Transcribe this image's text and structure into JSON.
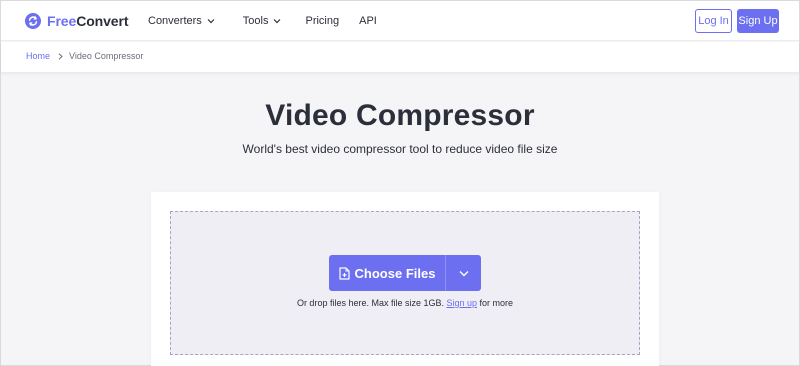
{
  "brand": {
    "free": "Free",
    "convert": "Convert",
    "accent": "#6c6ff0",
    "icon": "refresh-circle-icon"
  },
  "nav": {
    "items": [
      {
        "label": "Converters",
        "has_dropdown": true
      },
      {
        "label": "Tools",
        "has_dropdown": true
      },
      {
        "label": "Pricing",
        "has_dropdown": false
      },
      {
        "label": "API",
        "has_dropdown": false
      }
    ],
    "login_label": "Log In",
    "signup_label": "Sign Up"
  },
  "breadcrumb": {
    "home": "Home",
    "current": "Video Compressor",
    "separator_icon": "chevron-right-icon"
  },
  "hero": {
    "title": "Video Compressor",
    "subtitle": "World's best video compressor tool to reduce video file size"
  },
  "upload": {
    "choose_label": "Choose Files",
    "choose_icon": "file-plus-icon",
    "dropdown_icon": "chevron-down-icon",
    "hint_before": "Or drop files here. Max file size 1GB. ",
    "hint_link": "Sign up",
    "hint_after": " for more"
  }
}
